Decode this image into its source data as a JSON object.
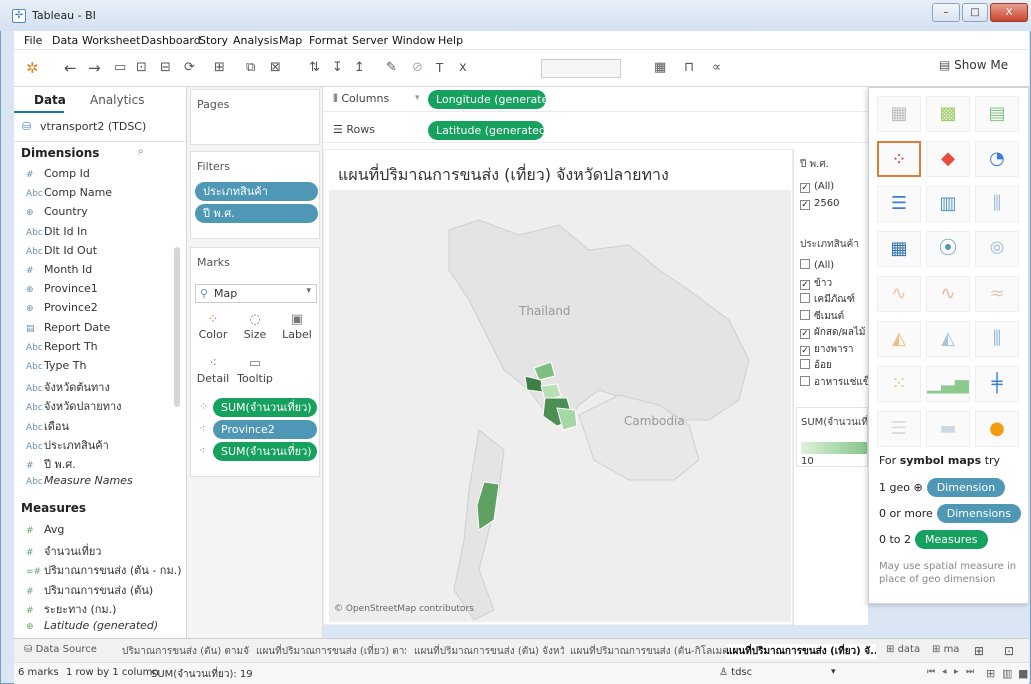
{
  "window": {
    "title": "Tableau - BI",
    "minimize_label": "–",
    "maximize_label": "□",
    "close_label": "X"
  },
  "menu": [
    "File",
    "Data",
    "Worksheet",
    "Dashboard",
    "Story",
    "Analysis",
    "Map",
    "Format",
    "Server",
    "Window",
    "Help"
  ],
  "toolbar": {
    "show_me_label": "Show Me"
  },
  "data_pane": {
    "tabs": [
      "Data",
      "Analytics"
    ],
    "datasource": "vtransport2 (TDSC)",
    "dimensions_header": "Dimensions",
    "dimensions": [
      {
        "icon": "#",
        "label": "Comp Id"
      },
      {
        "icon": "Abc",
        "label": "Comp Name"
      },
      {
        "icon": "⊕",
        "label": "Country"
      },
      {
        "icon": "Abc",
        "label": "Dlt Id In"
      },
      {
        "icon": "Abc",
        "label": "Dlt Id Out"
      },
      {
        "icon": "#",
        "label": "Month Id"
      },
      {
        "icon": "⊕",
        "label": "Province1"
      },
      {
        "icon": "⊕",
        "label": "Province2"
      },
      {
        "icon": "▤",
        "label": "Report Date"
      },
      {
        "icon": "Abc",
        "label": "Report Th"
      },
      {
        "icon": "Abc",
        "label": "Type Th"
      },
      {
        "icon": "Abc",
        "label": "จังหวัดต้นทาง"
      },
      {
        "icon": "Abc",
        "label": "จังหวัดปลายทาง"
      },
      {
        "icon": "Abc",
        "label": "เดือน"
      },
      {
        "icon": "Abc",
        "label": "ประเภทสินค้า"
      },
      {
        "icon": "#",
        "label": "ปี พ.ศ."
      },
      {
        "icon": "Abc",
        "label": "Measure Names"
      }
    ],
    "measures_header": "Measures",
    "measures": [
      {
        "icon": "#",
        "label": "Avg"
      },
      {
        "icon": "#",
        "label": "จำนวนเที่ยว"
      },
      {
        "icon": "=#",
        "label": "ปริมาณการขนส่ง (ตัน - กม.)"
      },
      {
        "icon": "#",
        "label": "ปริมาณการขนส่ง (ตัน)"
      },
      {
        "icon": "#",
        "label": "ระยะทาง (กม.)"
      },
      {
        "icon": "⊕",
        "label": "Latitude (generated)"
      }
    ]
  },
  "cards": {
    "pages_title": "Pages",
    "filters_title": "Filters",
    "filters": [
      "ประเภทสินค้า",
      "ปี พ.ศ."
    ],
    "marks_title": "Marks",
    "mark_type": "Map",
    "mark_buttons": [
      "Color",
      "Size",
      "Label",
      "Detail",
      "Tooltip"
    ],
    "mark_pills": [
      "SUM(จำนวนเที่ยว)",
      "Province2",
      "SUM(จำนวนเที่ยว)"
    ]
  },
  "shelves": {
    "columns_label": "Columns",
    "columns_pill": "Longitude (generated)",
    "rows_label": "Rows",
    "rows_pill": "Latitude (generated)"
  },
  "viz": {
    "title": "แผนที่ปริมาณการขนส่ง (เที่ยว) จังหวัดปลายทาง",
    "labels": {
      "thailand": "Thailand",
      "cambodia": "Cambodia"
    },
    "credit": "© OpenStreetMap contributors"
  },
  "filter_cards": {
    "year_title": "ปี พ.ศ.",
    "year_items": [
      {
        "label": "(All)",
        "checked": true
      },
      {
        "label": "2560",
        "checked": true
      }
    ],
    "type_title": "ประเภทสินค้า",
    "type_items": [
      {
        "label": "(All)",
        "checked": false
      },
      {
        "label": "ข้าว",
        "checked": true
      },
      {
        "label": "เคมีภัณฑ์",
        "checked": false
      },
      {
        "label": "ซีเมนต์",
        "checked": false
      },
      {
        "label": "ผักสด/ผลไม้",
        "checked": true
      },
      {
        "label": "ยางพารา",
        "checked": true
      },
      {
        "label": "อ้อย",
        "checked": false
      },
      {
        "label": "อาหารแช่แข็ง",
        "checked": false
      }
    ],
    "legend_title": "SUM(จำนวนเที่ยว)",
    "legend_min": "10",
    "legend_color": "#86c58c"
  },
  "show_me": {
    "hint_heading_prefix": "For ",
    "hint_heading_bold": "symbol maps",
    "hint_heading_suffix": " try",
    "hints": [
      {
        "prefix": "1 geo ⊕",
        "pill": "Dimension",
        "color": "#4e97b5"
      },
      {
        "prefix": "0 or more",
        "pill": "Dimensions",
        "color": "#4e97b5"
      },
      {
        "prefix": "0 to 2",
        "pill": "Measures",
        "color": "#17a15f"
      }
    ],
    "note": "May use spatial measure in place of geo dimension"
  },
  "sheet_tabs": [
    "Data Source",
    "ปริมาณการขนส่ง (ตัน) ตามจัง...",
    "แผนที่ปริมาณการขนส่ง (เที่ยว) ตาม...",
    "แผนที่ปริมาณการขนส่ง (ตัน) จังหวัด...",
    "แผนที่ปริมาณการขนส่ง (ตัน-กิโลเมต...",
    "แผนที่ปริมาณการขนส่ง (เที่ยว) จั...",
    "data",
    "ma"
  ],
  "status": {
    "marks": "6 marks",
    "rows": "1 row by 1 column",
    "sum": "SUM(จำนวนเที่ยว): 19",
    "user": "tdsc"
  }
}
